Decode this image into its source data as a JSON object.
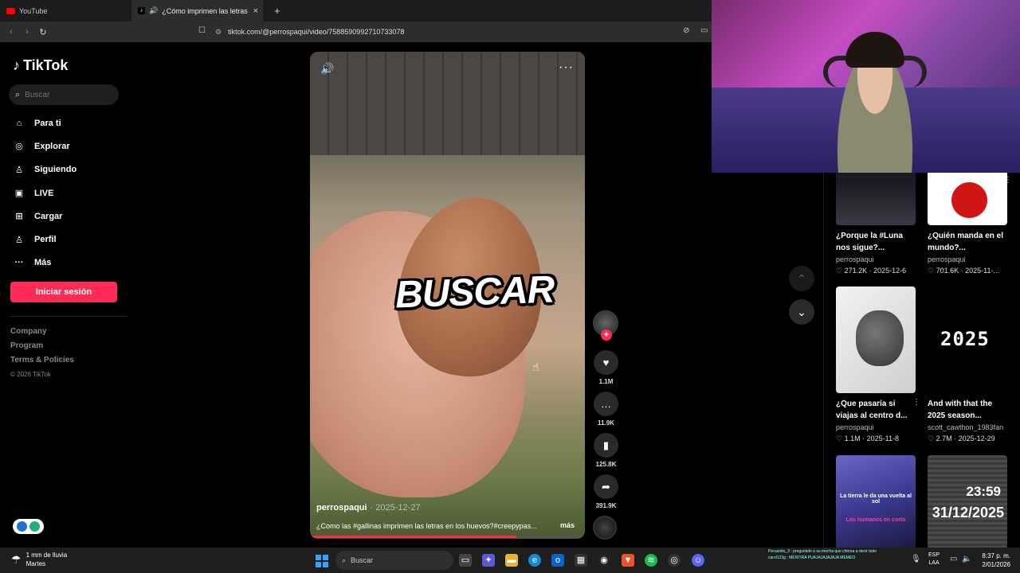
{
  "browser": {
    "tabs": [
      {
        "title": "YouTube",
        "active": false
      },
      {
        "title": "¿Cómo imprimen las letras la",
        "active": true
      }
    ],
    "new_tab": "+",
    "close": "×",
    "url": "tiktok.com/@perrospaqui/video/7588590992710733078"
  },
  "sidebar": {
    "logo": "TikTok",
    "search_placeholder": "Buscar",
    "items": [
      {
        "label": "Para ti",
        "icon": "home-icon"
      },
      {
        "label": "Explorar",
        "icon": "compass-icon"
      },
      {
        "label": "Siguiendo",
        "icon": "following-icon"
      },
      {
        "label": "LIVE",
        "icon": "live-icon"
      },
      {
        "label": "Cargar",
        "icon": "upload-icon"
      },
      {
        "label": "Perfil",
        "icon": "profile-icon"
      },
      {
        "label": "Más",
        "icon": "more-icon"
      }
    ],
    "login_button": "Iniciar sesión",
    "footer_links": [
      "Company",
      "Program",
      "Terms & Policies"
    ],
    "copyright": "© 2026 TikTok"
  },
  "video": {
    "overlay_text": "BUSCAR",
    "author": "perrospaqui",
    "date": "· 2025-12-27",
    "description": "¿Como las #gallinas imprimen las letras en los huevos?#creepypas...",
    "more_label": "más",
    "progress": 0.75
  },
  "actions": {
    "likes": "1.1M",
    "comments": "11.9K",
    "saves": "125.8K",
    "shares": "391.9K"
  },
  "recommendations": [
    {
      "title": "¿Porque la #Luna nos sigue?...",
      "author": "perrospaqui",
      "likes": "271.2K",
      "date": "2025-12-6"
    },
    {
      "title": "¿Quién manda en el mundo?...",
      "author": "perrospaqui",
      "likes": "701.6K",
      "date": "2025-11-..."
    },
    {
      "title": "¿Que pasaría si viajas al centro d...",
      "author": "perrospaqui",
      "likes": "1.1M",
      "date": "2025-11-8"
    },
    {
      "title": "And with that the 2025 season...",
      "author": "scott_cawthon_1983fan",
      "likes": "2.7M",
      "date": "2025-12-29",
      "thumb_text": "2025"
    },
    {
      "thumb_text": "La tierra le da una vuelta al sol",
      "thumb_subtext": "Los humanos en corto"
    },
    {
      "thumb_text": "23:59",
      "thumb_subtext": "31/12/2025"
    }
  ],
  "taskbar": {
    "weather_line1": "1 mm de lluvia",
    "weather_line2": "Martes",
    "search_placeholder": "Buscar",
    "chat_line1": "Peruanito_3 : preguntele a su mucha que chirrea a decir todo",
    "chat_line2": "carol123g : MENTIRA PUAJAJAJAJAJA MEMEO",
    "lang_line1": "ESP",
    "lang_line2": "LAA",
    "time": "8:37 p. m.",
    "date": "2/01/2026"
  },
  "colors": {
    "accent": "#fe2c55",
    "background": "#000000"
  }
}
